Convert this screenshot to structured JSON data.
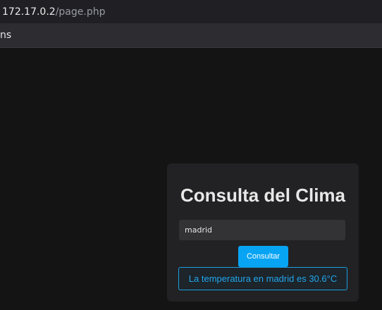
{
  "browser": {
    "url_host": "172.17.0.2",
    "url_path": "/page.php",
    "toolbar_label": "ns"
  },
  "weather_form": {
    "title": "Consulta del Clima",
    "city_value": "madrid",
    "submit_label": "Consultar",
    "result_text": "La temperatura en madrid es 30.6°C"
  },
  "colors": {
    "accent": "#08a4f4",
    "result_text": "#21a6ec",
    "page_background": "#141414",
    "card_background": "#222224"
  }
}
